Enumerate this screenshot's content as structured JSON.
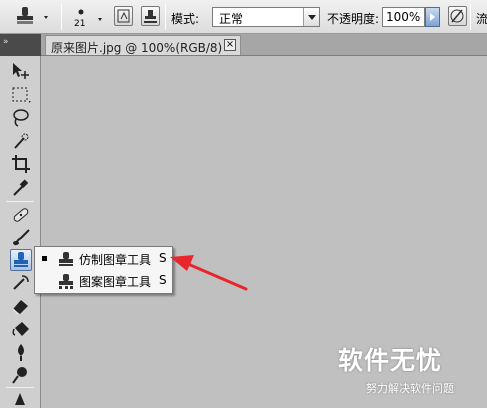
{
  "options_bar": {
    "brush_size": "21",
    "mode_label": "模式:",
    "mode_value": "正常",
    "opacity_label": "不透明度:",
    "opacity_value": "100%",
    "flow_label_partial": "流"
  },
  "document_tab": {
    "title": "原来图片.jpg @ 100%(RGB/8)",
    "close_glyph": "×"
  },
  "toolbar_header": {
    "collapse_glyph": "»"
  },
  "tools": [
    {
      "name": "move-tool",
      "icon": "move-icon"
    },
    {
      "name": "marquee-tool",
      "icon": "marquee-icon"
    },
    {
      "name": "lasso-tool",
      "icon": "lasso-icon"
    },
    {
      "name": "quick-selection-tool",
      "icon": "quick-selection-icon"
    },
    {
      "name": "crop-tool",
      "icon": "crop-icon"
    },
    {
      "name": "eyedropper-tool",
      "icon": "eyedropper-icon"
    },
    {
      "name": "healing-brush-tool",
      "icon": "bandage-icon"
    },
    {
      "name": "brush-tool",
      "icon": "brush-icon"
    },
    {
      "name": "clone-stamp-tool",
      "icon": "stamp-icon",
      "selected": true
    },
    {
      "name": "history-brush-tool",
      "icon": "history-brush-icon"
    },
    {
      "name": "eraser-tool",
      "icon": "eraser-icon"
    },
    {
      "name": "paint-bucket-tool",
      "icon": "bucket-icon"
    },
    {
      "name": "blur-tool",
      "icon": "blur-icon"
    },
    {
      "name": "dodge-tool",
      "icon": "dodge-icon"
    },
    {
      "name": "pen-tool",
      "icon": "pen-icon"
    }
  ],
  "flyout": {
    "items": [
      {
        "label": "仿制图章工具",
        "shortcut": "S",
        "active": true,
        "icon": "clone-stamp-icon"
      },
      {
        "label": "图案图章工具",
        "shortcut": "S",
        "active": false,
        "icon": "pattern-stamp-icon"
      }
    ]
  },
  "annotation": {
    "arrow_color": "#e8262b"
  },
  "watermark": {
    "main": "软件无忧",
    "sub": "努力解决软件问题"
  },
  "colors": {
    "canvas_bg": "#c0c0c0",
    "toolbar_bg": "#cfcfcf",
    "selection_blue": "#1f63b4"
  }
}
